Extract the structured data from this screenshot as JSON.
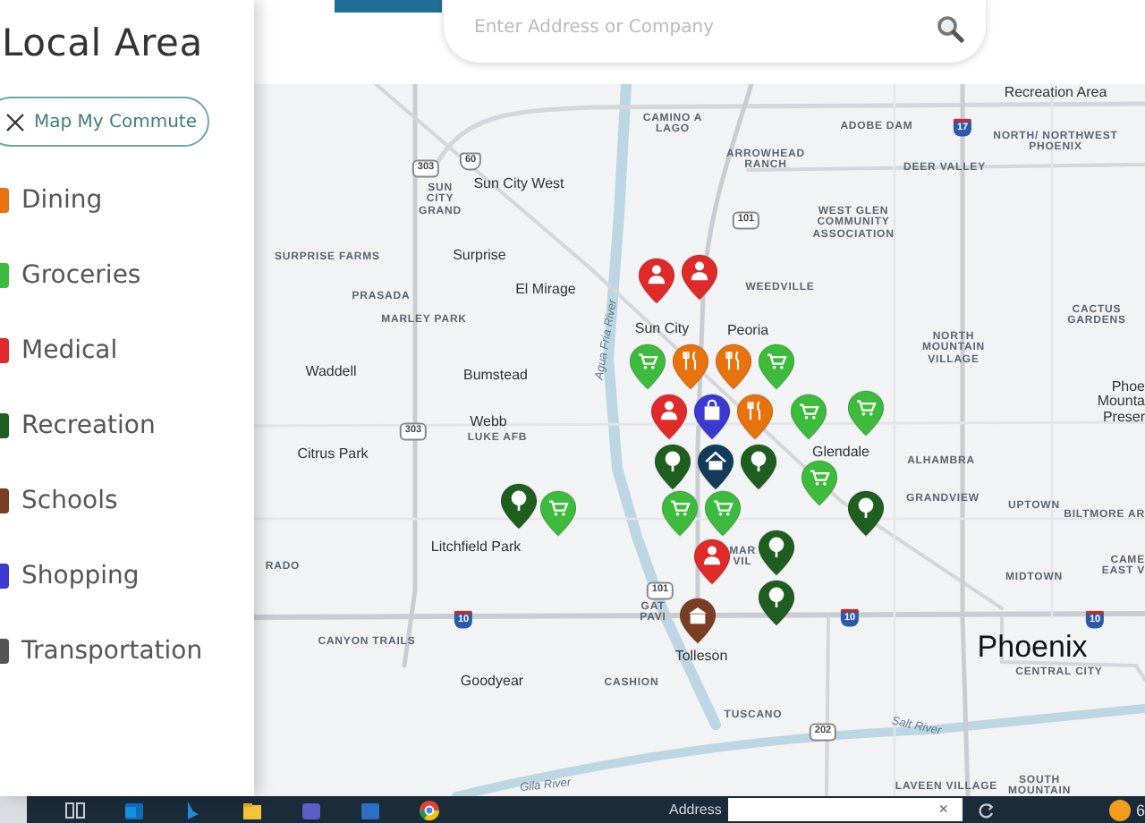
{
  "sidebar": {
    "title": "Local Area",
    "commute_button": "Map My Commute",
    "categories": [
      {
        "label": "Dining",
        "color": "#e8720c"
      },
      {
        "label": "Groceries",
        "color": "#3dbb3d"
      },
      {
        "label": "Medical",
        "color": "#e02a2a"
      },
      {
        "label": "Recreation",
        "color": "#1e5e1e"
      },
      {
        "label": "Schools",
        "color": "#7a3e22"
      },
      {
        "label": "Shopping",
        "color": "#3a3ad0"
      },
      {
        "label": "Transportation",
        "color": "#555555"
      }
    ]
  },
  "search": {
    "placeholder": "Enter Address or Company"
  },
  "map": {
    "labels": [
      {
        "text": "Recreation Area",
        "kind": "city"
      },
      {
        "text": "CAMINO A LAGO",
        "kind": "district"
      },
      {
        "text": "ADOBE DAM",
        "kind": "district"
      },
      {
        "text": "NORTH/ NORTHWEST PHOENIX",
        "kind": "district"
      },
      {
        "text": "SUN CITY GRAND",
        "kind": "district"
      },
      {
        "text": "Sun City West",
        "kind": "city"
      },
      {
        "text": "ARROWHEAD RANCH",
        "kind": "district"
      },
      {
        "text": "DEER VALLEY",
        "kind": "district"
      },
      {
        "text": "WEST GLEN COMMUNITY ASSOCIATION",
        "kind": "district"
      },
      {
        "text": "SURPRISE FARMS",
        "kind": "district"
      },
      {
        "text": "Surprise",
        "kind": "city"
      },
      {
        "text": "El Mirage",
        "kind": "city"
      },
      {
        "text": "WEEDVILLE",
        "kind": "district"
      },
      {
        "text": "PRASADA",
        "kind": "district"
      },
      {
        "text": "MARLEY PARK",
        "kind": "district"
      },
      {
        "text": "CACTUS GARDENS",
        "kind": "district"
      },
      {
        "text": "Sun City",
        "kind": "city"
      },
      {
        "text": "Agua Fria River",
        "kind": "water"
      },
      {
        "text": "NORTH MOUNTAIN VILLAGE",
        "kind": "district"
      },
      {
        "text": "Peoria",
        "kind": "city"
      },
      {
        "text": "Waddell",
        "kind": "city"
      },
      {
        "text": "Bumstead",
        "kind": "city"
      },
      {
        "text": "Webb",
        "kind": "city"
      },
      {
        "text": "LUKE AFB",
        "kind": "district"
      },
      {
        "text": "Phoe Mounta Preser",
        "kind": "city"
      },
      {
        "text": "Citrus Park",
        "kind": "city"
      },
      {
        "text": "Glendale",
        "kind": "city"
      },
      {
        "text": "ALHAMBRA",
        "kind": "district"
      },
      {
        "text": "GRANDVIEW",
        "kind": "district"
      },
      {
        "text": "UPTOWN",
        "kind": "district"
      },
      {
        "text": "BILTMORE AR",
        "kind": "district"
      },
      {
        "text": "Litchfield Park",
        "kind": "city"
      },
      {
        "text": "RADO",
        "kind": "district"
      },
      {
        "text": "MAR VIL",
        "kind": "district"
      },
      {
        "text": "MIDTOWN",
        "kind": "district"
      },
      {
        "text": "CAME EAST V",
        "kind": "district"
      },
      {
        "text": "GAT PAVI",
        "kind": "district"
      },
      {
        "text": "CANYON TRAILS",
        "kind": "district"
      },
      {
        "text": "Tolleson",
        "kind": "city"
      },
      {
        "text": "Phoenix",
        "kind": "major"
      },
      {
        "text": "Goodyear",
        "kind": "city"
      },
      {
        "text": "CASHION",
        "kind": "district"
      },
      {
        "text": "CENTRAL CITY",
        "kind": "district"
      },
      {
        "text": "TUSCANO",
        "kind": "district"
      },
      {
        "text": "Salt River",
        "kind": "water"
      },
      {
        "text": "Gila River",
        "kind": "water"
      },
      {
        "text": "LAVEEN VILLAGE",
        "kind": "district"
      },
      {
        "text": "SOUTH MOUNTAIN",
        "kind": "district"
      }
    ],
    "shields": [
      {
        "text": "303",
        "kind": "state"
      },
      {
        "text": "60",
        "kind": "us"
      },
      {
        "text": "17",
        "kind": "interstate"
      },
      {
        "text": "101",
        "kind": "state"
      },
      {
        "text": "303",
        "kind": "state"
      },
      {
        "text": "101",
        "kind": "state"
      },
      {
        "text": "10",
        "kind": "interstate"
      },
      {
        "text": "10",
        "kind": "interstate"
      },
      {
        "text": "10",
        "kind": "interstate"
      },
      {
        "text": "202",
        "kind": "state"
      }
    ],
    "pins": [
      {
        "kind": "medical"
      },
      {
        "kind": "medical"
      },
      {
        "kind": "groceries"
      },
      {
        "kind": "dining"
      },
      {
        "kind": "dining"
      },
      {
        "kind": "medical"
      },
      {
        "kind": "shopping"
      },
      {
        "kind": "dining"
      },
      {
        "kind": "groceries"
      },
      {
        "kind": "recreation"
      },
      {
        "kind": "recreation"
      },
      {
        "kind": "groceries"
      },
      {
        "kind": "groceries"
      },
      {
        "kind": "groceries"
      },
      {
        "kind": "home"
      },
      {
        "kind": "groceries"
      },
      {
        "kind": "groceries"
      },
      {
        "kind": "groceries"
      },
      {
        "kind": "recreation"
      },
      {
        "kind": "recreation"
      },
      {
        "kind": "recreation"
      },
      {
        "kind": "recreation"
      },
      {
        "kind": "medical"
      },
      {
        "kind": "schools"
      }
    ]
  },
  "taskbar": {
    "address_label": "Address",
    "clear_glyph": "×",
    "temperature": "6"
  }
}
